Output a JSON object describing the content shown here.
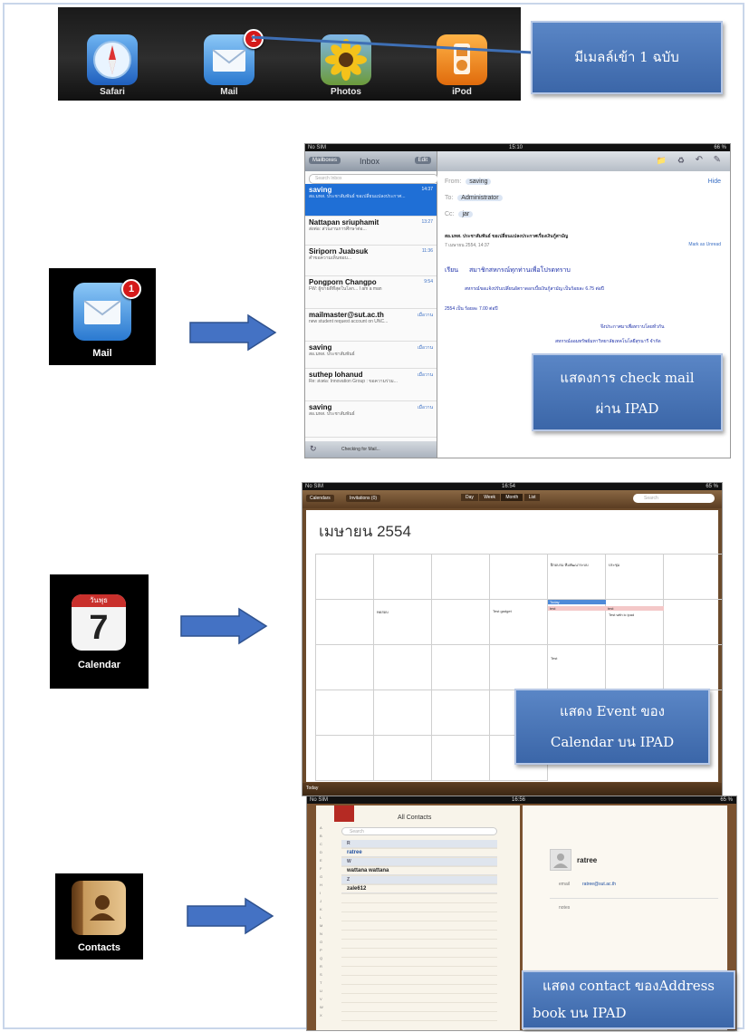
{
  "dock": {
    "apps": [
      {
        "label": "Safari",
        "icon": "safari-compass-icon"
      },
      {
        "label": "Mail",
        "icon": "mail-envelope-icon",
        "badge": "1"
      },
      {
        "label": "Photos",
        "icon": "sunflower-icon"
      },
      {
        "label": "iPod",
        "icon": "ipod-icon"
      }
    ]
  },
  "callouts": {
    "new_mail": "มีเมลล์เข้า 1 ฉบับ",
    "check_mail_line1": "แสดงการ check mail",
    "check_mail_line2": "ผ่าน IPAD",
    "calendar_line1": "แสดง Event ของ",
    "calendar_line2": "Calendar บน IPAD",
    "contact_line1": "แสดง contact ของAddress",
    "contact_line2": "book บน IPAD"
  },
  "icons": {
    "mail": {
      "label": "Mail",
      "badge": "1"
    },
    "calendar": {
      "label": "Calendar",
      "day": "7",
      "header": "วันพุธ"
    },
    "contacts": {
      "label": "Contacts"
    }
  },
  "mail_screen": {
    "status_left": "No SIM",
    "status_time": "15:10",
    "status_right": "66 %",
    "mailboxes_button": "Mailboxes",
    "inbox_title": "Inbox",
    "edit_button": "Edit",
    "search_placeholder": "Search Inbox",
    "messages": [
      {
        "from": "saving",
        "time": "14:37",
        "preview": "สอ.มทส. ประชาสัมพันธ์ ขอเปลี่ยนแปลงประกาศ..."
      },
      {
        "from": "Nattapan sriuphamit",
        "time": "13:27",
        "preview": "ส่งต่อ: ส่วนงานการศึกษาต่อ..."
      },
      {
        "from": "Siriporn Juabsuk",
        "time": "11:36",
        "preview": "คำขอความเห็นชอบ..."
      },
      {
        "from": "Pongporn Changpo",
        "time": "9:54",
        "preview": "FW: ผู้ขายดีที่สุดในโลก... I am a man"
      },
      {
        "from": "mailmaster@sut.ac.th",
        "time": "เมื่อวาน",
        "preview": "new student request account on UNC..."
      },
      {
        "from": "saving",
        "time": "เมื่อวาน",
        "preview": "สอ.มทส. ประชาสัมพันธ์"
      },
      {
        "from": "suthep lohanud",
        "time": "เมื่อวาน",
        "preview": "Re: ส่งต่อ: Innovation Group : ขอความร่วม..."
      },
      {
        "from": "saving",
        "time": "เมื่อวาน",
        "preview": "สอ.มทส. ประชาสัมพันธ์"
      }
    ],
    "checking": "Checking for Mail...",
    "from_label": "From:",
    "from_value": "saving",
    "hide": "Hide",
    "to_label": "To:",
    "to_value": "Administrator",
    "cc_label": "Cc:",
    "cc_value": "jar",
    "subject": "สอ.มทส. ประชาสัมพันธ์ ขอเปลี่ยนแปลงประกาศเรื่องเงินกู้สามัญ",
    "date": "7 เมษายน 2554, 14:37",
    "mark_unread": "Mark as Unread",
    "greeting": "เรียน",
    "greeting_to": "สมาชิกสหกรณ์ทุกท่านเพื่อโปรดทราบ",
    "body1": "สหกรณ์ขอแจ้งปรับเปลี่ยนอัตราดอกเบี้ยเงินกู้สามัญ เป็นร้อยละ 6.75 ต่อปี",
    "body2": "2554 เป็น ร้อยละ 7.00 ต่อปี",
    "body3": "จึงประกาศมาเพื่อทราบโดยทั่วกัน",
    "signature": "สหกรณ์ออมทรัพย์มหาวิทยาลัยเทคโนโลยีสุรนารี จำกัด"
  },
  "calendar_screen": {
    "status_left": "No SIM",
    "status_time": "16:54",
    "status_right": "65 %",
    "calendars_button": "Calendars",
    "invitations_button": "Invitations (0)",
    "views": [
      "Day",
      "Week",
      "Month",
      "List"
    ],
    "search_placeholder": "Search",
    "month_title": "เมษายน 2554",
    "events": [
      "ฝึกอบรม ทีมพัฒนาระบบ",
      "ประชุม",
      "ทดสอบ",
      "Test gadget",
      "Today",
      "test",
      "test",
      "Test with ic ipad",
      "Test"
    ],
    "footer_left": "Today"
  },
  "contacts_screen": {
    "status_left": "No SIM",
    "status_time": "16:56",
    "status_right": "65 %",
    "title": "All Contacts",
    "search_placeholder": "Search",
    "sections": [
      "R",
      "W",
      "Z"
    ],
    "contacts": [
      "ratree",
      "wattana wattana",
      "zale612"
    ],
    "detail_name": "ratree",
    "email_label": "email",
    "email_value": "ratree@sut.ac.th",
    "notes_label": "notes"
  },
  "colors": {
    "callout_blue": "#4a76b8",
    "arrow_blue": "#4472c4",
    "mail_selected": "#1f6fd6",
    "calendar_leather": "#6b4a2b"
  }
}
